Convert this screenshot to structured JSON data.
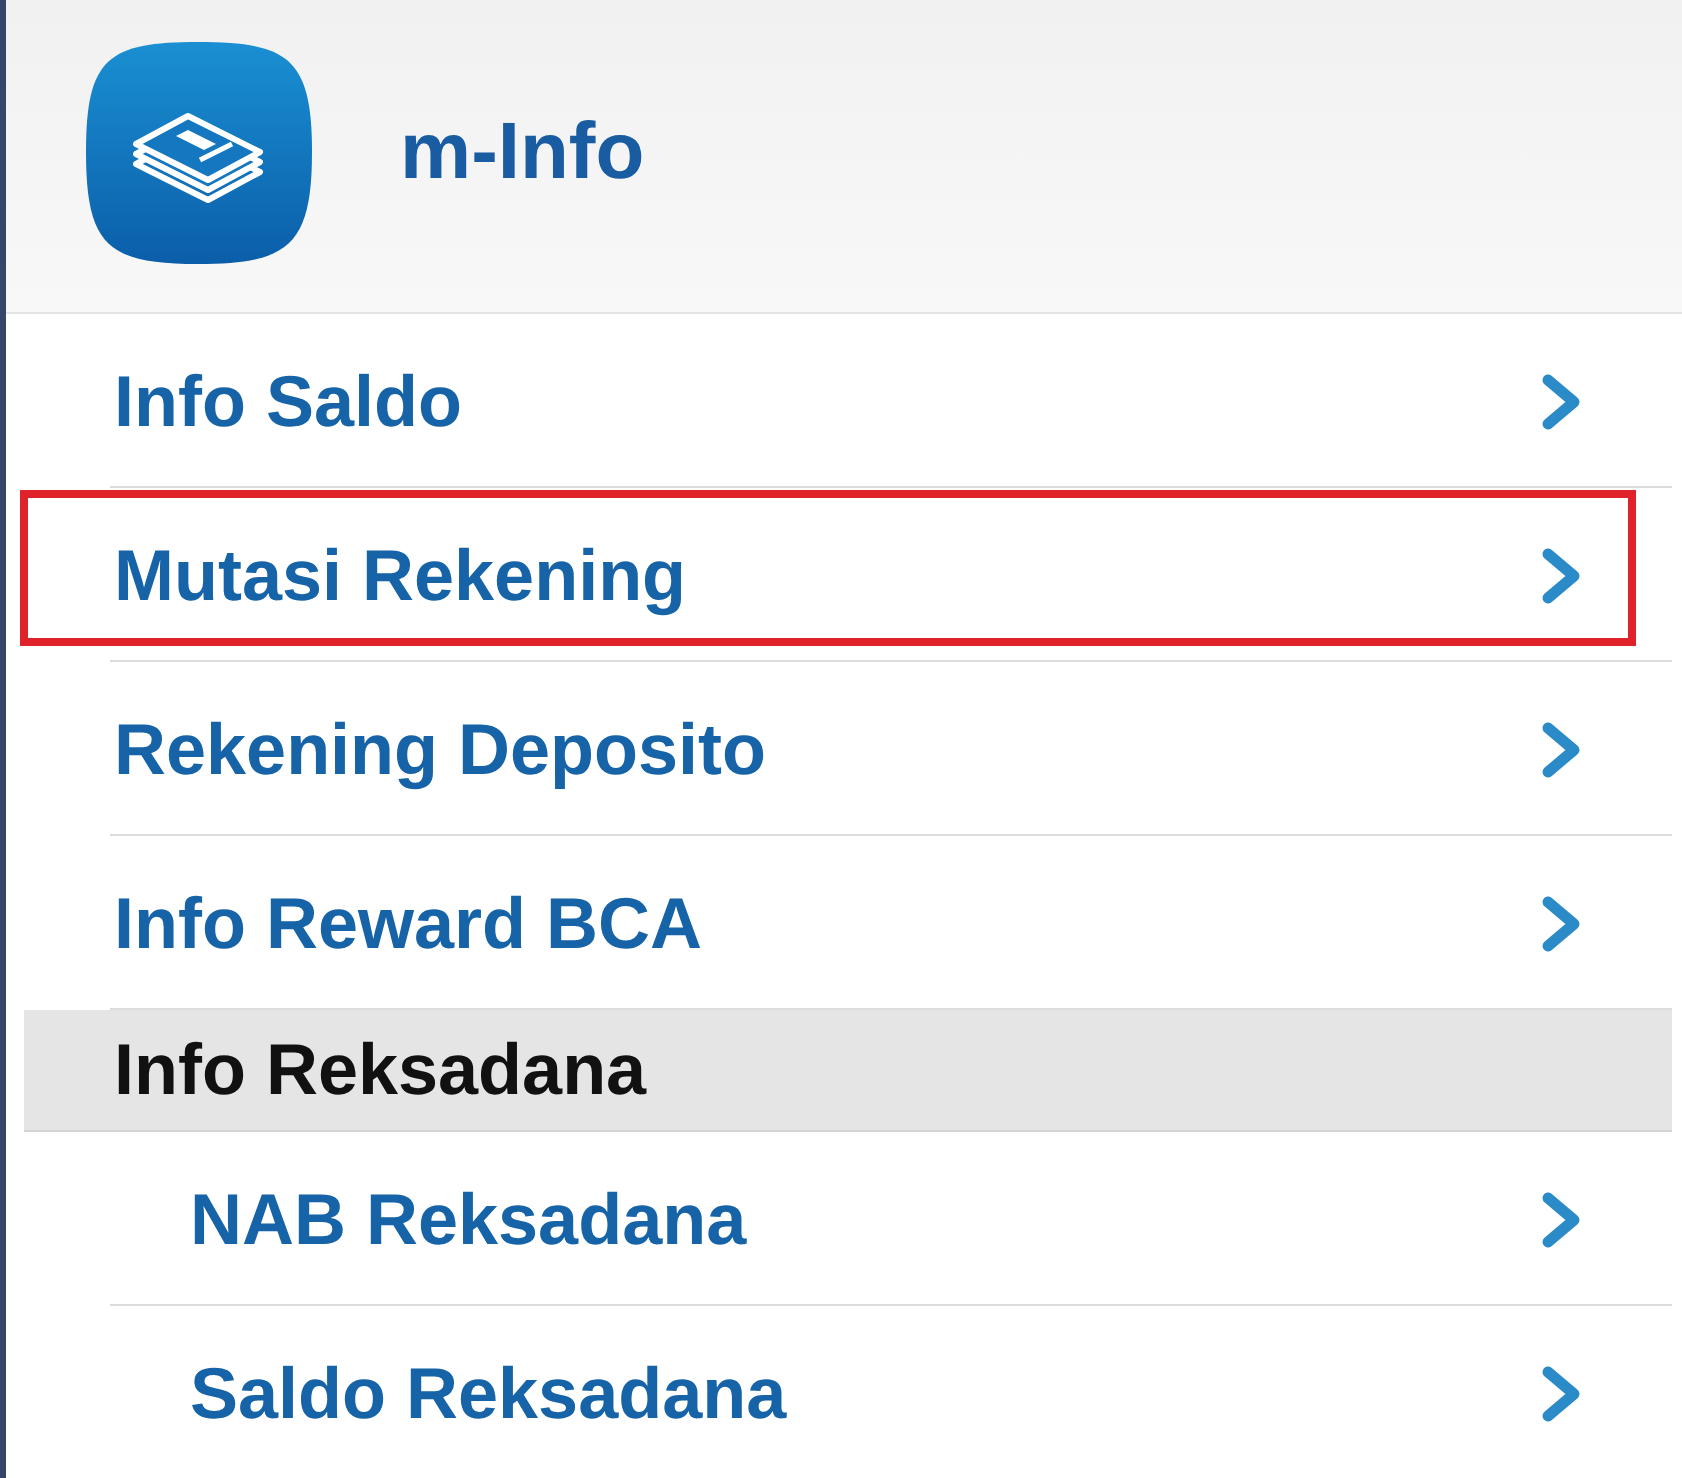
{
  "header": {
    "title": "m-Info"
  },
  "items": [
    {
      "kind": "link",
      "label": "Info Saldo",
      "highlighted": false
    },
    {
      "kind": "link",
      "label": "Mutasi Rekening",
      "highlighted": true
    },
    {
      "kind": "link",
      "label": "Rekening Deposito",
      "highlighted": false
    },
    {
      "kind": "link",
      "label": "Info Reward BCA",
      "highlighted": false
    },
    {
      "kind": "section",
      "label": "Info Reksadana",
      "children": [
        {
          "label": "NAB Reksadana",
          "highlighted": false
        },
        {
          "label": "Saldo Reksadana",
          "highlighted": false
        }
      ]
    }
  ]
}
